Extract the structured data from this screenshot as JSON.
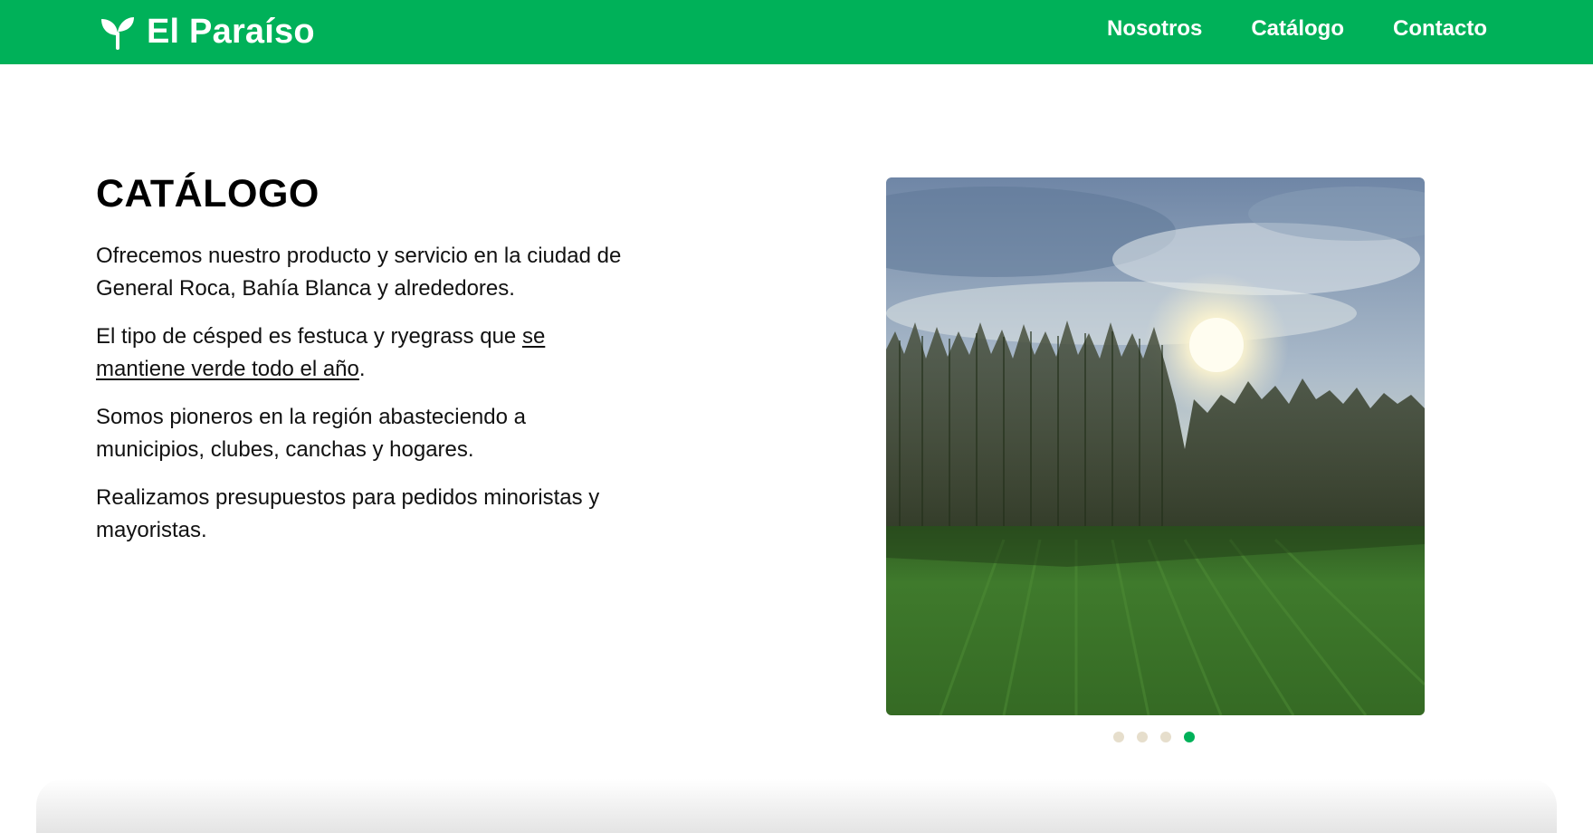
{
  "navbar": {
    "brand_name": "El Paraíso",
    "brand_icon": "sprout-icon",
    "background": "#00b159",
    "links": [
      {
        "label": "Nosotros"
      },
      {
        "label": "Catálogo"
      },
      {
        "label": "Contacto"
      }
    ]
  },
  "main": {
    "title": "CATÁLOGO",
    "paragraph1": "Ofrecemos nuestro producto y servicio en la ciudad de General Roca, Bahía Blanca y alrededores.",
    "paragraph2": {
      "before": "El tipo de césped es festuca y ryegrass que ",
      "underlined": "se mantiene verde todo el año",
      "after": "."
    },
    "paragraph3": "Somos pioneros en la región abasteciendo a municipios, clubes, canchas y hogares.",
    "paragraph4": "Realizamos presupuestos para pedidos minoristas y mayoristas."
  },
  "carousel": {
    "slide_count": 4,
    "active_slide": 4,
    "dot_color": "#e6decc",
    "active_dot_color": "#00b159"
  }
}
